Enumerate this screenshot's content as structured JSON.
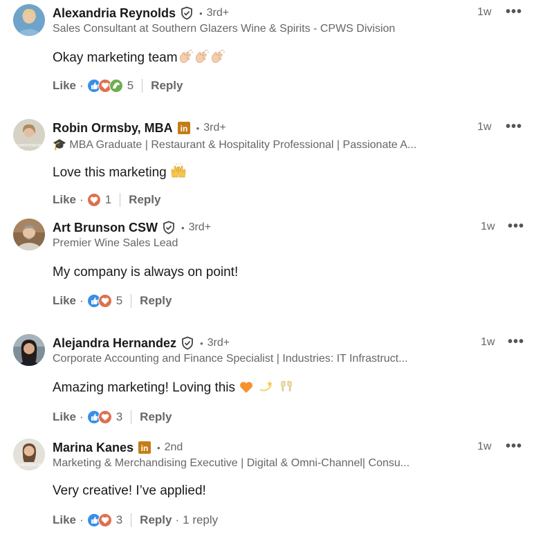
{
  "comments": [
    {
      "name": "Alexandria Reynolds",
      "badge": "verified-icon",
      "degree": "3rd+",
      "headline": "Sales Consultant at Southern Glazers Wine & Spirits - CPWS Division",
      "time": "1w",
      "text": "Okay marketing team",
      "emoji": [
        "clapping-hands-icon",
        "clapping-hands-icon",
        "clapping-hands-icon"
      ],
      "reactions": [
        "like-reaction-icon",
        "love-reaction-icon",
        "support-reaction-icon"
      ],
      "reaction_count": "5",
      "like_label": "Like",
      "reply_label": "Reply"
    },
    {
      "name": "Robin Ormsby, MBA",
      "badge": "linkedin-premium-icon",
      "degree": "3rd+",
      "headline": "🎓 MBA Graduate | Restaurant & Hospitality Professional | Passionate A...",
      "time": "1w",
      "text": "Love this marketing",
      "emoji": [
        "raising-hands-icon"
      ],
      "reactions": [
        "love-reaction-icon"
      ],
      "reaction_count": "1",
      "like_label": "Like",
      "reply_label": "Reply"
    },
    {
      "name": "Art Brunson CSW",
      "badge": "verified-icon",
      "degree": "3rd+",
      "headline": "Premier Wine Sales Lead",
      "time": "1w",
      "text": "My company is always on point!",
      "emoji": [],
      "reactions": [
        "like-reaction-icon",
        "love-reaction-icon"
      ],
      "reaction_count": "5",
      "like_label": "Like",
      "reply_label": "Reply"
    },
    {
      "name": "Alejandra Hernandez",
      "badge": "verified-icon",
      "degree": "3rd+",
      "headline": "Corporate Accounting and Finance Specialist | Industries: IT Infrastruct...",
      "time": "1w",
      "text": "Amazing marketing! Loving this",
      "emoji": [
        "orange-heart-icon",
        "dizzy-icon",
        "clinking-glasses-icon"
      ],
      "reactions": [
        "like-reaction-icon",
        "love-reaction-icon"
      ],
      "reaction_count": "3",
      "like_label": "Like",
      "reply_label": "Reply"
    },
    {
      "name": "Marina Kanes",
      "badge": "linkedin-premium-icon",
      "degree": "2nd",
      "headline": "Marketing & Merchandising Executive | Digital & Omni-Channel| Consu...",
      "time": "1w",
      "text": "Very creative! I’ve applied!",
      "emoji": [],
      "reactions": [
        "like-reaction-icon",
        "love-reaction-icon"
      ],
      "reaction_count": "3",
      "like_label": "Like",
      "reply_label": "Reply",
      "replies_label": "1 reply"
    }
  ],
  "colors": {
    "like": "#378fe9",
    "love": "#df704d",
    "support": "#6dae4f",
    "premium": "#c37d16"
  }
}
